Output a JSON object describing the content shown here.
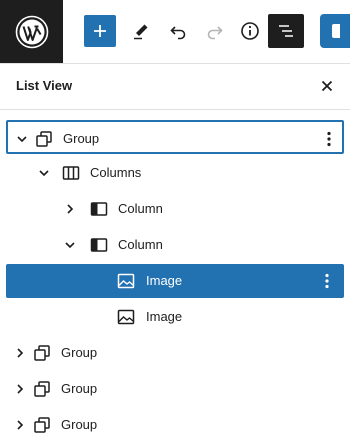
{
  "panel": {
    "title": "List View"
  },
  "tree": [
    {
      "label": "Group",
      "level": 1,
      "icon": "group-icon",
      "expander": "chevron-down-icon",
      "state": "focused",
      "options": true
    },
    {
      "label": "Columns",
      "level": 2,
      "icon": "columns-icon",
      "expander": "chevron-down-icon"
    },
    {
      "label": "Column",
      "level": 3,
      "icon": "column-icon",
      "expander": "chevron-right-icon"
    },
    {
      "label": "Column",
      "level": 3,
      "icon": "column-icon",
      "expander": "chevron-down-icon"
    },
    {
      "label": "Image",
      "level": 4,
      "icon": "image-icon",
      "state": "selected",
      "options": true
    },
    {
      "label": "Image",
      "level": 4,
      "icon": "image-icon"
    },
    {
      "label": "Group",
      "level": 1,
      "icon": "group-icon",
      "expander": "chevron-right-icon"
    },
    {
      "label": "Group",
      "level": 1,
      "icon": "group-icon",
      "expander": "chevron-right-icon"
    },
    {
      "label": "Group",
      "level": 1,
      "icon": "group-icon",
      "expander": "chevron-right-icon"
    }
  ],
  "colors": {
    "accent": "#2271b1",
    "dark": "#1e1e1e"
  }
}
